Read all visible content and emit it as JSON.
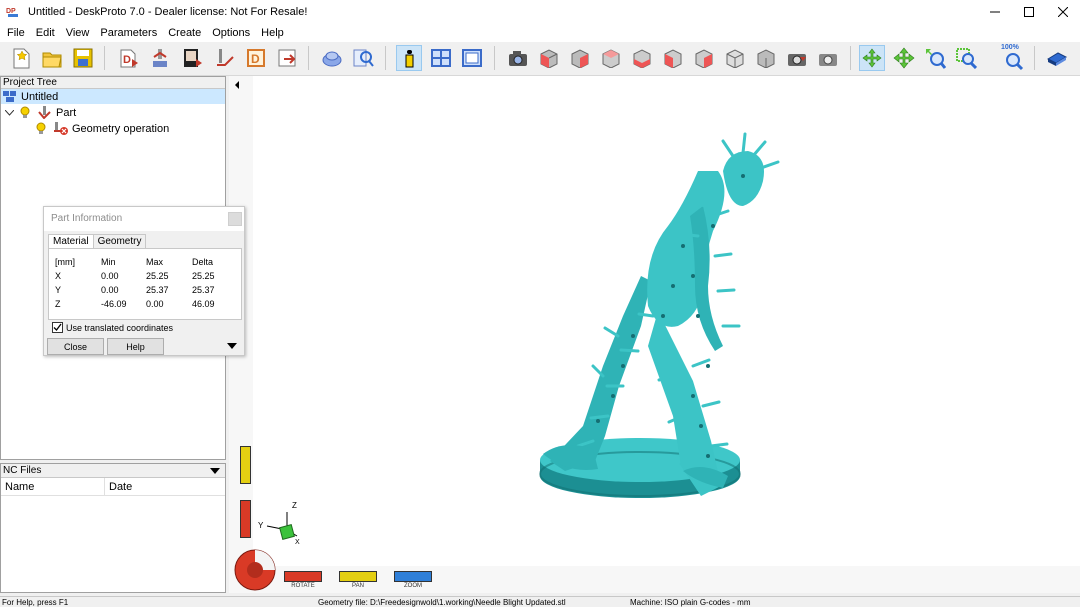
{
  "window": {
    "title": "Untitled - DeskProto 7.0 - Dealer license: Not For Resale!"
  },
  "menu": [
    "File",
    "Edit",
    "View",
    "Parameters",
    "Create",
    "Options",
    "Help"
  ],
  "toolbar": {
    "zoom_level": "100%",
    "icons": [
      "new-file-icon",
      "open-folder-icon",
      "save-icon",
      "import-geometry-icon",
      "operation-icon",
      "project-icon",
      "toolpath-icon",
      "d-icon",
      "export-icon",
      "part-view-icon",
      "find-icon",
      "info-icon",
      "window-layout-icon",
      "preview-icon",
      "camera-icon",
      "view-front-icon",
      "view-back-icon",
      "view-left-icon",
      "view-right-icon",
      "view-top-icon",
      "view-bottom-icon",
      "view-iso-icon",
      "view-iso-2-icon",
      "render-icon",
      "snapshot-icon",
      "rotate-icon",
      "pan-icon",
      "zoom-in-icon",
      "zoom-window-icon",
      "zoom-100-icon",
      "manual-icon"
    ]
  },
  "project_tree": {
    "header": "Project Tree",
    "items": [
      {
        "label": "Untitled",
        "level": 0
      },
      {
        "label": "Part",
        "level": 1
      },
      {
        "label": "Geometry operation",
        "level": 2
      }
    ]
  },
  "nc_files": {
    "header": "NC Files",
    "columns": [
      "Name",
      "Date"
    ]
  },
  "part_info": {
    "title": "Part Information",
    "tabs": [
      "Material",
      "Geometry"
    ],
    "columns": [
      "[mm]",
      "Min",
      "Max",
      "Delta"
    ],
    "rows": [
      {
        "axis": "X",
        "min": "0.00",
        "max": "25.25",
        "delta": "25.25"
      },
      {
        "axis": "Y",
        "min": "0.00",
        "max": "25.37",
        "delta": "25.37"
      },
      {
        "axis": "Z",
        "min": "-46.09",
        "max": "0.00",
        "delta": "46.09"
      }
    ],
    "checkbox_label": "Use translated coordinates",
    "checkbox_checked": true,
    "close_label": "Close",
    "help_label": "Help"
  },
  "viewport": {
    "axis_labels": {
      "z": "Z",
      "y": "Y",
      "x": "X"
    },
    "controls": [
      {
        "label": "ROTATE",
        "color": "#d93a26"
      },
      {
        "label": "PAN",
        "color": "#e4cf12"
      },
      {
        "label": "ZOOM",
        "color": "#2f7fd8"
      }
    ],
    "model_color": "#3cc4c6"
  },
  "status": {
    "help": "For Help, press F1",
    "geometry": "Geometry file: D:\\Freedesignwold\\1.working\\Needle Blight Updated.stl",
    "machine": "Machine: ISO plain G-codes - mm"
  }
}
